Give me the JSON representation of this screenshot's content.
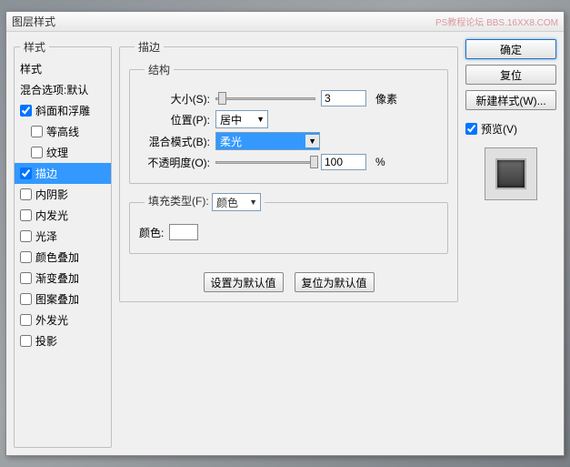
{
  "title": "图层样式",
  "watermark": "PS教程论坛\nBBS.16XX8.COM",
  "styles_header": "样式",
  "styles_list": [
    {
      "label": "样式",
      "checked": null,
      "selected": false,
      "header": true
    },
    {
      "label": "混合选项:默认",
      "checked": null,
      "selected": false,
      "header": true
    },
    {
      "label": "斜面和浮雕",
      "checked": true,
      "selected": false
    },
    {
      "label": "等高线",
      "checked": false,
      "selected": false,
      "indent": true
    },
    {
      "label": "纹理",
      "checked": false,
      "selected": false,
      "indent": true
    },
    {
      "label": "描边",
      "checked": true,
      "selected": true
    },
    {
      "label": "内阴影",
      "checked": false,
      "selected": false
    },
    {
      "label": "内发光",
      "checked": false,
      "selected": false
    },
    {
      "label": "光泽",
      "checked": false,
      "selected": false
    },
    {
      "label": "颜色叠加",
      "checked": false,
      "selected": false
    },
    {
      "label": "渐变叠加",
      "checked": false,
      "selected": false
    },
    {
      "label": "图案叠加",
      "checked": false,
      "selected": false
    },
    {
      "label": "外发光",
      "checked": false,
      "selected": false
    },
    {
      "label": "投影",
      "checked": false,
      "selected": false
    }
  ],
  "main": {
    "title": "描边",
    "structure": {
      "legend": "结构",
      "size_label": "大小(S):",
      "size_value": "3",
      "size_unit": "像素",
      "position_label": "位置(P):",
      "position_value": "居中",
      "blend_label": "混合模式(B):",
      "blend_value": "柔光",
      "opacity_label": "不透明度(O):",
      "opacity_value": "100",
      "opacity_unit": "%"
    },
    "fill": {
      "legend_label": "填充类型(F):",
      "legend_value": "颜色",
      "color_label": "颜色:",
      "color_value": "#ffffff"
    },
    "default_btn": "设置为默认值",
    "reset_btn": "复位为默认值"
  },
  "right": {
    "ok": "确定",
    "cancel": "复位",
    "new_style": "新建样式(W)...",
    "preview_label": "预览(V)",
    "preview_checked": true
  }
}
